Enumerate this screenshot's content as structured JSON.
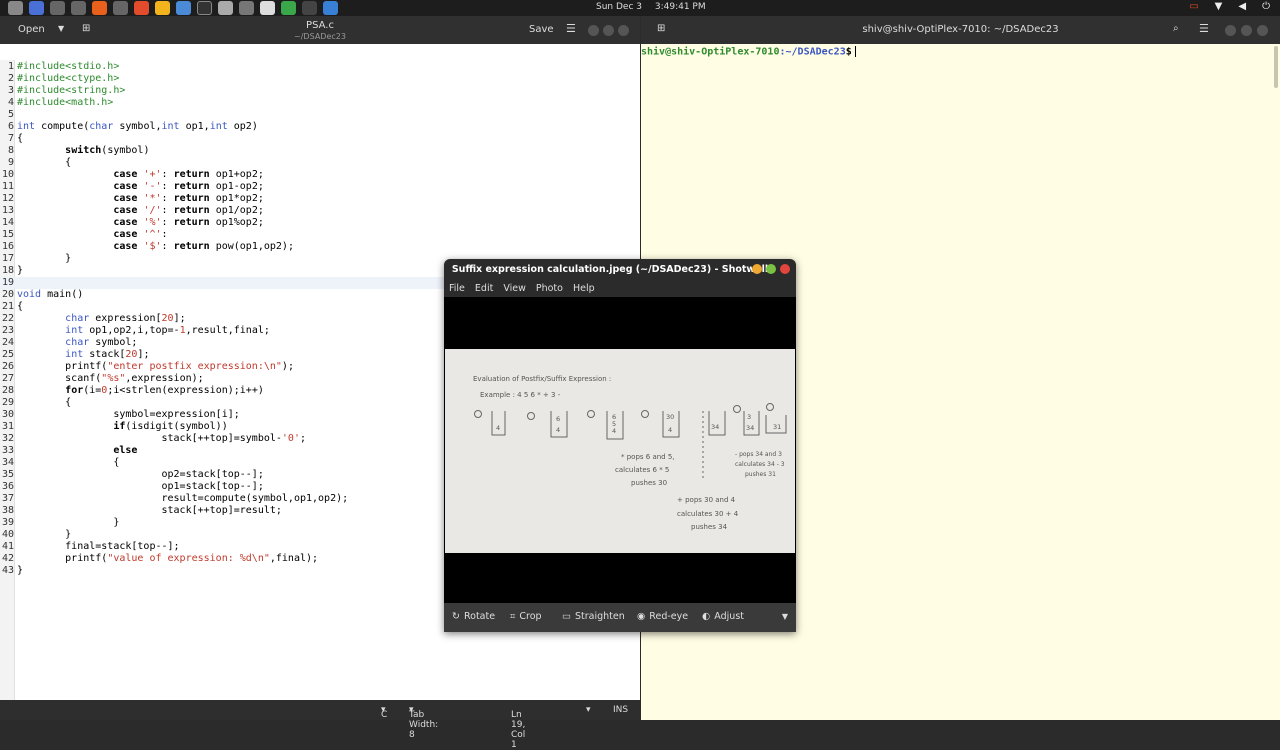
{
  "topbar": {
    "clock_date": "Sun Dec 3",
    "clock_time": "3:49:41 PM",
    "tray_icons": [
      "battery-icon",
      "wifi-icon",
      "volume-icon",
      "power-icon"
    ]
  },
  "editor": {
    "open_label": "Open",
    "title": "PSA.c",
    "subtitle": "~/DSADec23",
    "save_label": "Save",
    "status": {
      "language": "C",
      "tab_width": "Tab Width: 8",
      "position": "Ln 19, Col 1",
      "mode": "INS"
    },
    "lines": [
      "#include<stdio.h>",
      "#include<ctype.h>",
      "#include<string.h>",
      "#include<math.h>",
      "",
      "int compute(char symbol,int op1,int op2)",
      "{",
      "        switch(symbol)",
      "        {",
      "                case '+': return op1+op2;",
      "                case '-': return op1-op2;",
      "                case '*': return op1*op2;",
      "                case '/': return op1/op2;",
      "                case '%': return op1%op2;",
      "                case '^':",
      "                case '$': return pow(op1,op2);",
      "        }",
      "}",
      "",
      "void main()",
      "{",
      "        char expression[20];",
      "        int op1,op2,i,top=-1,result,final;",
      "        char symbol;",
      "        int stack[20];",
      "        printf(\"enter postfix expression:\\n\");",
      "        scanf(\"%s\",expression);",
      "        for(i=0;i<strlen(expression);i++)",
      "        {",
      "                symbol=expression[i];",
      "                if(isdigit(symbol))",
      "                        stack[++top]=symbol-'0';",
      "                else",
      "                {",
      "                        op2=stack[top--];",
      "                        op1=stack[top--];",
      "                        result=compute(symbol,op1,op2);",
      "                        stack[++top]=result;",
      "                }",
      "        }",
      "        final=stack[top--];",
      "        printf(\"value of expression: %d\\n\",final);",
      "}"
    ]
  },
  "terminal": {
    "title": "shiv@shiv-OptiPlex-7010: ~/DSADec23",
    "prompt_user": "shiv@shiv-OptiPlex-7010",
    "prompt_path": ":~/DSADec23",
    "prompt_symbol": "$"
  },
  "shotwell": {
    "title": "Suffix expression calculation.jpeg (~/DSADec23) - Shotwell",
    "menu": [
      "File",
      "Edit",
      "View",
      "Photo",
      "Help"
    ],
    "tools": [
      "Rotate",
      "Crop",
      "Straighten",
      "Red-eye",
      "Adjust"
    ],
    "photo_text": {
      "heading": "Evaluation of Postfix/Suffix Expression :",
      "example": "Example :   4 5 6 * + 3 -",
      "note1": [
        "* pops 6 and 5,",
        "calculates 6 * 5",
        "pushes 30"
      ],
      "note2": [
        "+ pops 30 and 4",
        "calculates 30 + 4",
        "pushes 34"
      ],
      "note3": [
        "- pops 34 and 3",
        "calculates 34 - 3",
        "pushes 31"
      ]
    }
  }
}
